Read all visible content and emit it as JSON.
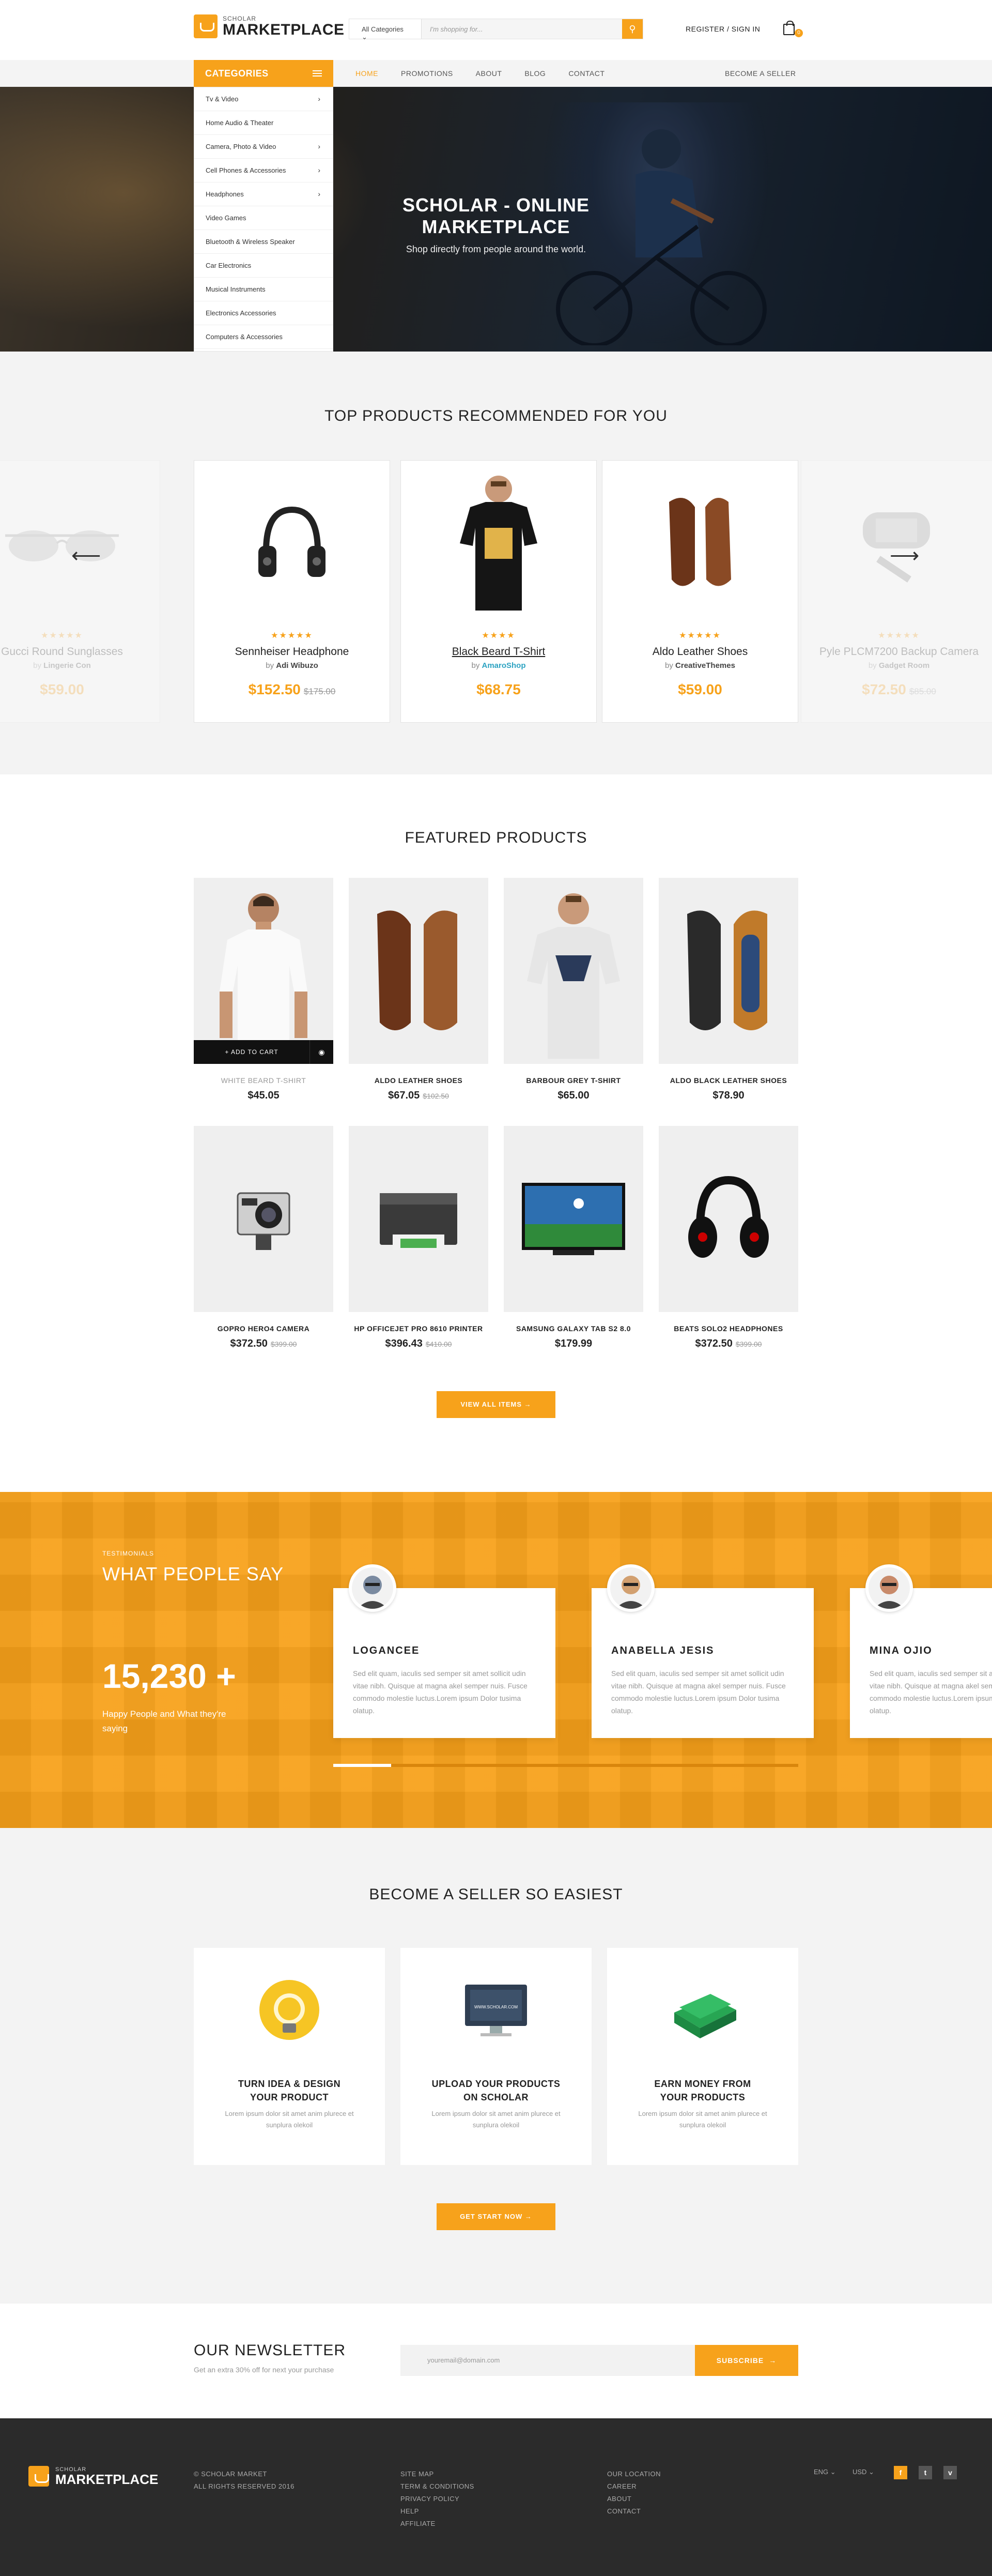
{
  "header": {
    "logo_small": "SCHOLAR",
    "logo_big": "MARKETPLACE",
    "category_select": "All Categories",
    "search_placeholder": "I'm shopping for...",
    "register": "REGISTER / SIGN IN",
    "cart_count": "0"
  },
  "nav": {
    "categories_label": "CATEGORIES",
    "items": [
      "HOME",
      "PROMOTIONS",
      "ABOUT",
      "BLOG",
      "CONTACT"
    ],
    "become_seller": "BECOME A SELLER"
  },
  "categories": [
    {
      "label": "Tv & Video",
      "chevron": true
    },
    {
      "label": "Home Audio & Theater",
      "chevron": false
    },
    {
      "label": "Camera, Photo & Video",
      "chevron": true
    },
    {
      "label": "Cell Phones & Accessories",
      "chevron": true
    },
    {
      "label": "Headphones",
      "chevron": true
    },
    {
      "label": "Video Games",
      "chevron": false
    },
    {
      "label": "Bluetooth & Wireless Speaker",
      "chevron": false
    },
    {
      "label": "Car Electronics",
      "chevron": false
    },
    {
      "label": "Musical Instruments",
      "chevron": false
    },
    {
      "label": "Electronics Accessories",
      "chevron": false
    },
    {
      "label": "Computers & Accessories",
      "chevron": false
    }
  ],
  "hero": {
    "title": "SCHOLAR - ONLINE MARKETPLACE",
    "subtitle": "Shop directly from people around the world."
  },
  "top_products": {
    "title": "TOP PRODUCTS RECOMMENDED FOR YOU",
    "items": [
      {
        "name": "Gucci Round Sunglasses",
        "by": "by",
        "seller": "Lingerie Con",
        "price": "$59.00",
        "old": "",
        "stars": "★★★★★",
        "icon": "sunglasses-icon",
        "faded": true
      },
      {
        "name": "Sennheiser Headphone",
        "by": "by",
        "seller": "Adi Wibuzo",
        "price": "$152.50",
        "old": "$175.00",
        "stars": "★★★★★",
        "icon": "headphone-icon",
        "faded": false
      },
      {
        "name": "Black Beard T-Shirt",
        "by": "by",
        "seller": "AmaroShop",
        "price": "$68.75",
        "old": "",
        "stars": "★★★★",
        "icon": "tshirt-icon",
        "faded": false
      },
      {
        "name": "Aldo Leather Shoes",
        "by": "by",
        "seller": "CreativeThemes",
        "price": "$59.00",
        "old": "",
        "stars": "★★★★★",
        "icon": "shoes-icon",
        "faded": false
      },
      {
        "name": "Pyle PLCM7200 Backup Camera",
        "by": "by",
        "seller": "Gadget Room",
        "price": "$72.50",
        "old": "$85.00",
        "stars": "★★★★★",
        "icon": "camera-mirror-icon",
        "faded": true
      }
    ]
  },
  "featured": {
    "title": "FEATURED PRODUCTS",
    "add_to_cart": "ADD TO CART",
    "view_all": "VIEW ALL ITEMS",
    "items": [
      {
        "name": "WHITE BEARD T-SHIRT",
        "price": "$45.05",
        "old": ""
      },
      {
        "name": "ALDO LEATHER SHOES",
        "price": "$67.05",
        "old": "$102.50"
      },
      {
        "name": "BARBOUR GREY T-SHIRT",
        "price": "$65.00",
        "old": ""
      },
      {
        "name": "ALDO BLACK LEATHER SHOES",
        "price": "$78.90",
        "old": ""
      },
      {
        "name": "GOPRO HERO4 CAMERA",
        "price": "$372.50",
        "old": "$399.00"
      },
      {
        "name": "HP OFFICEJET PRO 8610 PRINTER",
        "price": "$396.43",
        "old": "$410.00"
      },
      {
        "name": "SAMSUNG GALAXY TAB S2 8.0",
        "price": "$179.99",
        "old": ""
      },
      {
        "name": "BEATS SOLO2 HEADPHONES",
        "price": "$372.50",
        "old": "$399.00"
      }
    ]
  },
  "testimonials": {
    "label": "TESTIMONIALS",
    "title": "WHAT PEOPLE SAY",
    "count": "15,230 +",
    "count_caption": "Happy People and What they're saying",
    "items": [
      {
        "name": "LOGANCEE",
        "text": "Sed elit quam, iaculis sed semper sit amet sollicit udin vitae nibh. Quisque at magna akel semper nuis. Fusce commodo molestie luctus.Lorem ipsum Dolor tusima olatup."
      },
      {
        "name": "ANABELLA JESIS",
        "text": "Sed elit quam, iaculis sed semper sit amet sollicit udin vitae nibh. Quisque at magna akel semper nuis. Fusce commodo molestie luctus.Lorem ipsum Dolor tusima olatup."
      },
      {
        "name": "MINA OJIO",
        "text": "Sed elit quam, iaculis sed semper sit amet sollicit udin vitae nibh. Quisque at magna akel semper nuis. Fusce commodo molestie luctus.Lorem ipsum Dolor tusima olatup."
      }
    ]
  },
  "seller": {
    "title": "BECOME A SELLER SO EASIEST",
    "cta": "GET START NOW",
    "items": [
      {
        "title1": "TURN IDEA & DESIGN",
        "title2": "YOUR PRODUCT",
        "text": "Lorem ipsum dolor sit amet anim plurece et sunplura olekoil"
      },
      {
        "title1": "UPLOAD YOUR PRODUCTS",
        "title2": "ON SCHOLAR",
        "text": "Lorem ipsum dolor sit amet anim plurece et sunplura olekoil",
        "screen": "WWW.SCHOLAR.COM"
      },
      {
        "title1": "EARN MONEY FROM",
        "title2": "YOUR PRODUCTS",
        "text": "Lorem ipsum dolor sit amet anim plurece et sunplura olekoil"
      }
    ]
  },
  "newsletter": {
    "title": "OUR NEWSLETTER",
    "subtitle": "Get an extra 30% off for next your purchase",
    "placeholder": "youremail@domain.com",
    "button": "SUBSCRIBE"
  },
  "footer": {
    "logo_small": "SCHOLAR",
    "logo_big": "MARKETPLACE",
    "copyright": [
      "© SCHOLAR MARKET",
      "ALL RIGHTS RESERVED 2016"
    ],
    "links1": [
      "SITE MAP",
      "TERM & CONDITIONS",
      "PRIVACY POLICY",
      "HELP",
      "AFFILIATE"
    ],
    "links2": [
      "OUR LOCATION",
      "CAREER",
      "ABOUT",
      "CONTACT"
    ],
    "language": "ENG",
    "currency": "USD",
    "social": [
      "f",
      "t",
      "v"
    ]
  },
  "colors": {
    "accent": "#f7a21b",
    "dark": "#2b2b2b"
  }
}
